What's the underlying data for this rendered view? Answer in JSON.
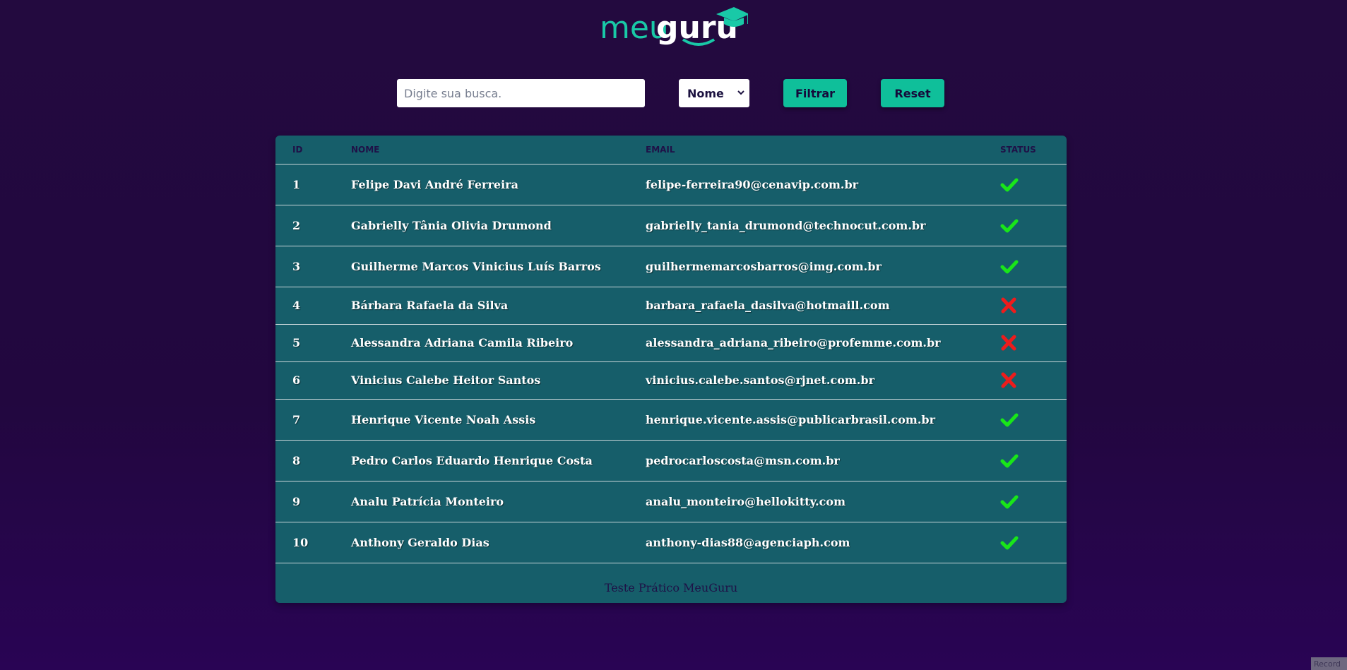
{
  "logo": {
    "text_light": "meu",
    "text_bold": "guru"
  },
  "search": {
    "placeholder": "Digite sua busca."
  },
  "filter_select": {
    "selected": "Nome"
  },
  "buttons": {
    "filter_label": "Filtrar",
    "reset_label": "Reset"
  },
  "table": {
    "headers": {
      "id": "ID",
      "name": "NOME",
      "email": "EMAIL",
      "status": "STATUS"
    },
    "rows": [
      {
        "id": "1",
        "name": "Felipe Davi André Ferreira",
        "email": "felipe-ferreira90@cenavip.com.br",
        "status": "check"
      },
      {
        "id": "2",
        "name": "Gabrielly Tânia Olivia Drumond",
        "email": "gabrielly_tania_drumond@technocut.com.br",
        "status": "check"
      },
      {
        "id": "3",
        "name": "Guilherme Marcos Vinicius Luís Barros",
        "email": "guilhermemarcosbarros@img.com.br",
        "status": "check"
      },
      {
        "id": "4",
        "name": "Bárbara Rafaela da Silva",
        "email": "barbara_rafaela_dasilva@hotmaill.com",
        "status": "cross"
      },
      {
        "id": "5",
        "name": "Alessandra Adriana Camila Ribeiro",
        "email": "alessandra_adriana_ribeiro@profemme.com.br",
        "status": "cross"
      },
      {
        "id": "6",
        "name": "Vinicius Calebe Heitor Santos",
        "email": "vinicius.calebe.santos@rjnet.com.br",
        "status": "cross"
      },
      {
        "id": "7",
        "name": "Henrique Vicente Noah Assis",
        "email": "henrique.vicente.assis@publicarbrasil.com.br",
        "status": "check"
      },
      {
        "id": "8",
        "name": "Pedro Carlos Eduardo Henrique Costa",
        "email": "pedrocarloscosta@msn.com.br",
        "status": "check"
      },
      {
        "id": "9",
        "name": "Analu Patrícia Monteiro",
        "email": "analu_monteiro@hellokitty.com",
        "status": "check"
      },
      {
        "id": "10",
        "name": "Anthony Geraldo Dias",
        "email": "anthony-dias88@agenciaph.com",
        "status": "check"
      }
    ],
    "footer": "Teste Prático MeuGuru"
  },
  "colors": {
    "accent": "#0fbf9a",
    "check": "#19e619",
    "cross": "#ee1c1c",
    "table_bg": "#165e6a",
    "page_bg": "#230a3f"
  },
  "record_tag": "Record"
}
